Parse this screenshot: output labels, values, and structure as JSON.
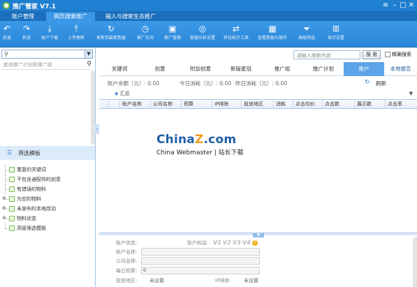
{
  "app": {
    "title": "推广管家 V7.1"
  },
  "window": {
    "min_icon": "minimize-icon",
    "max_icon": "maximize-icon",
    "close_icon": "close-icon"
  },
  "menu": {
    "tabs": [
      "账户管理",
      "网页搜索推广",
      "输入与搜索生态推广"
    ],
    "active_index": 1
  },
  "toolbar": {
    "items": [
      {
        "label": "后退",
        "icon": "back-arrow-icon"
      },
      {
        "label": "前进",
        "icon": "forward-arrow-icon"
      },
      {
        "label": "账户下载",
        "icon": "download-icon"
      },
      {
        "label": "上传更新",
        "icon": "upload-icon"
      },
      {
        "label": "更新到最新数据",
        "icon": "refresh-icon"
      },
      {
        "label": "推广实况",
        "icon": "clock-icon"
      },
      {
        "label": "推广管理",
        "icon": "monitor-icon"
      },
      {
        "label": "数据分析设置",
        "icon": "target-icon"
      },
      {
        "label": "转化统计工具",
        "icon": "exchange-icon"
      },
      {
        "label": "查看数据与操作",
        "icon": "grid-icon"
      },
      {
        "label": "高级筛选",
        "icon": "filter-icon"
      },
      {
        "label": "显示设置",
        "icon": "layout-icon"
      }
    ]
  },
  "left": {
    "account_placeholder": "",
    "search_placeholder": "查找推广计划和推广组",
    "filter_title": "筛选模板",
    "tree": [
      {
        "label": "重复的关键词",
        "expandable": false
      },
      {
        "label": "不包含通配符的创意",
        "expandable": false
      },
      {
        "label": "有错误的物料",
        "expandable": false
      },
      {
        "label": "为空的物料",
        "expandable": true
      },
      {
        "label": "未发布的本地改动",
        "expandable": true
      },
      {
        "label": "物料状态",
        "expandable": true
      },
      {
        "label": "高级筛选模板",
        "expandable": false
      }
    ]
  },
  "right": {
    "search_placeholder": "请输入搜索内容",
    "search_button": "搜 索",
    "precise_search_label": "精确搜索",
    "tabs": [
      "关键词",
      "创意",
      "附加创意",
      "新版星冠",
      "推广组",
      "推广计划",
      "账户",
      "本地报告"
    ],
    "active_tab_index": 6,
    "balance": {
      "balance_label": "账户余额（元）: 0.00",
      "today_label": "今日消耗（元）: 0.00",
      "yesterday_label": "昨日消耗（元）: 0.00",
      "refresh_label": "刷新"
    },
    "grid_title": "汇总",
    "columns": [
      "账户名称",
      "公司名称",
      "预算",
      "IP排除",
      "投放地区",
      "消耗",
      "点击均价",
      "点击数",
      "展示数",
      "点击率"
    ],
    "watermark": {
      "brand_main": "China",
      "brand_z": "Z",
      "brand_tail": ".com",
      "sub": "China Webmaster | 站长下载"
    },
    "detail": {
      "status_label": "账户状态:",
      "rights_label": "账户权益:",
      "rights_badges": [
        "V1",
        "V2",
        "V3",
        "V4"
      ],
      "account_name_label": "账户名称:",
      "company_label": "公司名称:",
      "budget_label": "每日预算:",
      "budget_value": "0",
      "region_label": "投放地区:",
      "region_value": "未设置",
      "ip_label": "IP排除:",
      "ip_value": "未设置"
    }
  },
  "colors": {
    "title_blue": "#1f7fd0",
    "toolbar_blue": "#2a86d8",
    "active_tab": "#5da4e8",
    "brand_orange": "#f29b1d"
  }
}
